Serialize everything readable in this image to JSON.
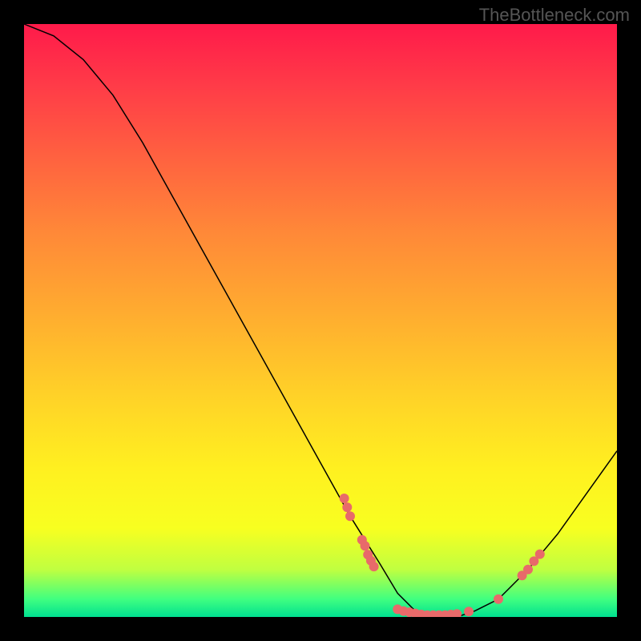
{
  "watermark": "TheBottleneck.com",
  "chart_data": {
    "type": "line",
    "title": "",
    "xlabel": "",
    "ylabel": "",
    "xlim": [
      0,
      100
    ],
    "ylim": [
      0,
      100
    ],
    "grid": false,
    "series": [
      {
        "name": "bottleneck-curve",
        "x": [
          0,
          5,
          10,
          15,
          20,
          25,
          30,
          35,
          40,
          45,
          50,
          55,
          60,
          63,
          66,
          70,
          73,
          76,
          80,
          85,
          90,
          95,
          100
        ],
        "y": [
          100,
          98,
          94,
          88,
          80,
          71,
          62,
          53,
          44,
          35,
          26,
          17,
          9,
          4,
          1,
          0,
          0,
          1,
          3,
          8,
          14,
          21,
          28
        ]
      }
    ],
    "highlight_points": [
      {
        "x": 54,
        "y": 20
      },
      {
        "x": 54.5,
        "y": 18.5
      },
      {
        "x": 55,
        "y": 17
      },
      {
        "x": 57,
        "y": 13
      },
      {
        "x": 57.5,
        "y": 12
      },
      {
        "x": 58,
        "y": 10.5
      },
      {
        "x": 58.5,
        "y": 9.5
      },
      {
        "x": 59,
        "y": 8.5
      },
      {
        "x": 63,
        "y": 1.3
      },
      {
        "x": 64,
        "y": 1.0
      },
      {
        "x": 65,
        "y": 0.8
      },
      {
        "x": 66,
        "y": 0.6
      },
      {
        "x": 67,
        "y": 0.4
      },
      {
        "x": 68,
        "y": 0.3
      },
      {
        "x": 69,
        "y": 0.3
      },
      {
        "x": 70,
        "y": 0.3
      },
      {
        "x": 71,
        "y": 0.3
      },
      {
        "x": 72,
        "y": 0.4
      },
      {
        "x": 73,
        "y": 0.5
      },
      {
        "x": 75,
        "y": 0.9
      },
      {
        "x": 80,
        "y": 3
      },
      {
        "x": 84,
        "y": 7
      },
      {
        "x": 85,
        "y": 8
      },
      {
        "x": 86,
        "y": 9.4
      },
      {
        "x": 87,
        "y": 10.6
      }
    ],
    "gradient_stops": [
      {
        "pos": 0,
        "color": "#ff1a4a"
      },
      {
        "pos": 100,
        "color": "#00e090"
      }
    ]
  }
}
